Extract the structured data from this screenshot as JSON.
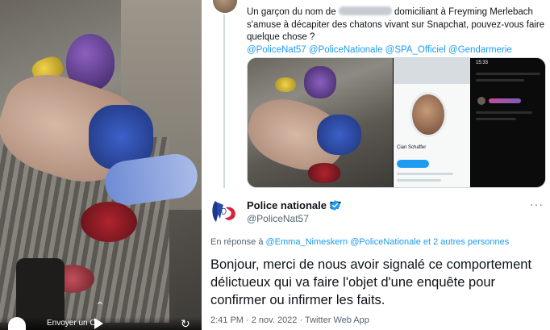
{
  "video": {
    "send_label": "Envoyer un Ch",
    "icons": [
      "play-icon",
      "refresh-icon",
      "chevron-up-icon"
    ]
  },
  "tweet_top": {
    "text_before": "Un garçon du nom de",
    "text_after": "domiciliant à Freyming Merlebach s'amuse à décapiter des chatons vivant sur Snapchat, pouvez-vous faire quelque chose ?",
    "mentions": "@PoliceNat57 @PoliceNationale @SPA_Officiel @Gendarmerie",
    "media_time": "15:33",
    "media_profile_name": "Cian Schaffer"
  },
  "reply_tweet": {
    "display_name": "Police nationale 57",
    "handle": "@PoliceNat57",
    "reply_prefix": "En réponse à",
    "reply_mention_1": "@Emma_Nimeskern",
    "reply_mention_2": "@PoliceNationale",
    "reply_suffix": "et 2 autres personnes",
    "body": "Bonjour, merci de nous avoir signalé ce comportement délictueux qui va faire l'objet d'une enquête pour confirmer ou infirmer les faits.",
    "timestamp": "2:41 PM · 2 nov. 2022 · Twitter Web App"
  },
  "colors": {
    "link": "#1d9bf0",
    "text": "#0f1419",
    "muted": "#536471",
    "verified": "#1d9bf0"
  }
}
